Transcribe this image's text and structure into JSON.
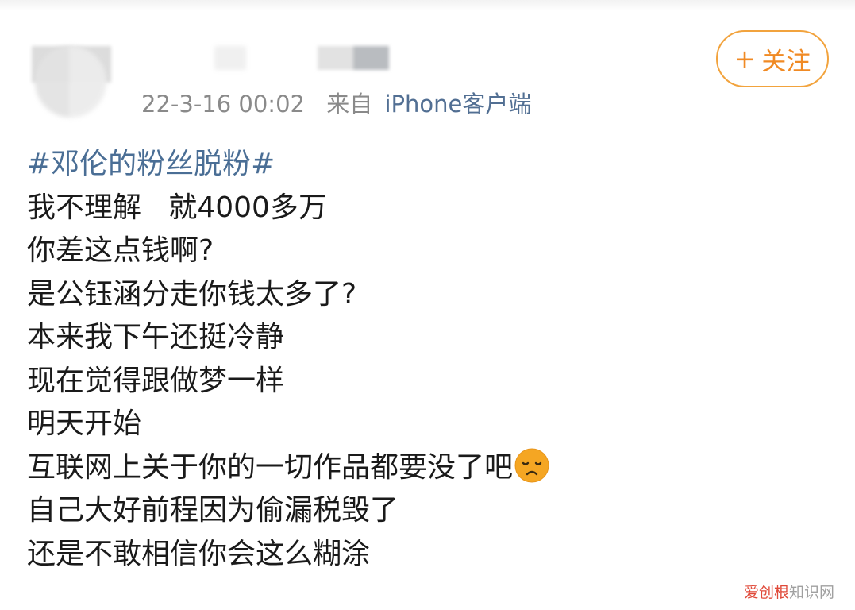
{
  "post": {
    "date": "22-3-16 00:02",
    "source_prefix": "来自",
    "source_client": "iPhone客户端",
    "follow": {
      "plus": "+",
      "label": "关注"
    },
    "hashtag": "#邓伦的粉丝脱粉#",
    "lines": [
      "我不理解   就4000多万",
      "你差这点钱啊?",
      "是公钰涵分走你钱太多了?",
      "本来我下午还挺冷静",
      "现在觉得跟做梦一样",
      "明天开始",
      "互联网上关于你的一切作品都要没了吧",
      "自己大好前程因为偷漏税毁了",
      "还是不敢相信你会这么糊涂"
    ],
    "emoji": "sad-face-icon"
  },
  "watermark": {
    "brand": "爱创根",
    "suffix": "知识网"
  },
  "colors": {
    "hashtag": "#4a6e95",
    "follow_accent": "#f08a24",
    "meta_text": "#8a8a8a",
    "client_link": "#526f93",
    "emoji_face": "#f5a623"
  }
}
